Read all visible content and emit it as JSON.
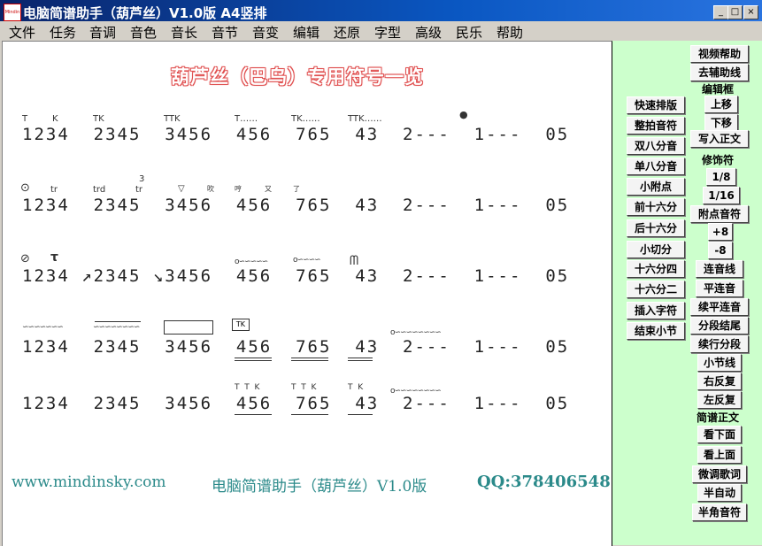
{
  "window": {
    "title": "电脑简谱助手（葫芦丝）V1.0版    A4竖排",
    "icon_text": "Mindin",
    "controls": [
      "_",
      "□",
      "×"
    ]
  },
  "menu": [
    "文件",
    "任务",
    "音调",
    "音色",
    "音长",
    "音节",
    "音变",
    "编辑",
    "还原",
    "字型",
    "高级",
    "民乐",
    "帮助"
  ],
  "sheet": {
    "title": "葫芦丝（巴乌）专用符号一览",
    "rows": [
      "1234  2345  3456  456  765  43  2---  1---  05",
      "1234  2345  3456  456  765  43  2---  1---  05",
      "1234 ↗2345 ↘3456  456  765  43  2---  1---  05",
      "1234  2345  3456  456  765  43  2---  1---  05",
      "1234  2345  3456  456  765  43  2---  1---  05"
    ],
    "marks": {
      "r1_t": "T",
      "r1_k": "K",
      "r1_tk": "TK",
      "r1_ttk": "TTK",
      "r1_tdots": "T……",
      "r1_tkdots": "TK……",
      "r1_ttkdots": "TTK……",
      "r1_dot": "●",
      "r2_circle": "⊙",
      "r2_tr": "tr",
      "r2_trd": "trd",
      "r2_3": "3",
      "r2_tr2": "tr",
      "r2_v": "▽",
      "r2_ying": "吹",
      "r2_hui": "哼",
      "r2_you": "又",
      "r2_le": "了",
      "r3_circle": "⊘",
      "r3_tau": "τ",
      "r3_wave1": "o∽∽∽∽∽",
      "r3_wave2": "o∽∽∽∽",
      "r3_m": "ᗰ",
      "r4_wave1": "∽∽∽∽∽∽∽",
      "r4_wave2": "∽∽∽∽∽∽∽∽",
      "r4_tk": "TK",
      "r4_wave3": "o∽∽∽∽∽∽∽∽",
      "r5_ttk1": "T  T  K",
      "r5_ttk2": "T  T  K",
      "r5_tk": "T  K",
      "r5_wave": "o∽∽∽∽∽∽∽∽"
    },
    "footer": {
      "url": "www.mindinsky.com",
      "app": "电脑简谱助手（葫芦丝）V1.0版",
      "qq": "QQ:378406548"
    }
  },
  "sidebar": {
    "left_buttons": [
      "快速排版",
      "整拍音符",
      "双八分音",
      "单八分音",
      "小附点",
      "前十六分",
      "后十六分",
      "小切分",
      "十六分四",
      "十六分二",
      "插入字符",
      "结束小节"
    ],
    "video_help": "视频帮助",
    "remove_aux": "去辅助线",
    "edit_box_label": "编辑框",
    "up": "上移",
    "down": "下移",
    "write_body": "写入正文",
    "decor_label": "修饰符",
    "eighth": "1/8",
    "sixteenth": "1/16",
    "dotted_note": "附点音符",
    "plus8": "+8",
    "minus8": "-8",
    "slur": "连音线",
    "flat_slur": "平连音",
    "cont_flat_slur": "续平连音",
    "seg_end": "分段结尾",
    "cont_seg": "续行分段",
    "barline": "小节线",
    "right_repeat": "右反复",
    "left_repeat": "左反复",
    "score_body_label": "简谱正文",
    "view_below": "看下面",
    "view_above": "看上面",
    "fine_lyrics": "微调歌词",
    "semi_auto": "半自动",
    "half_note": "半角音符"
  }
}
